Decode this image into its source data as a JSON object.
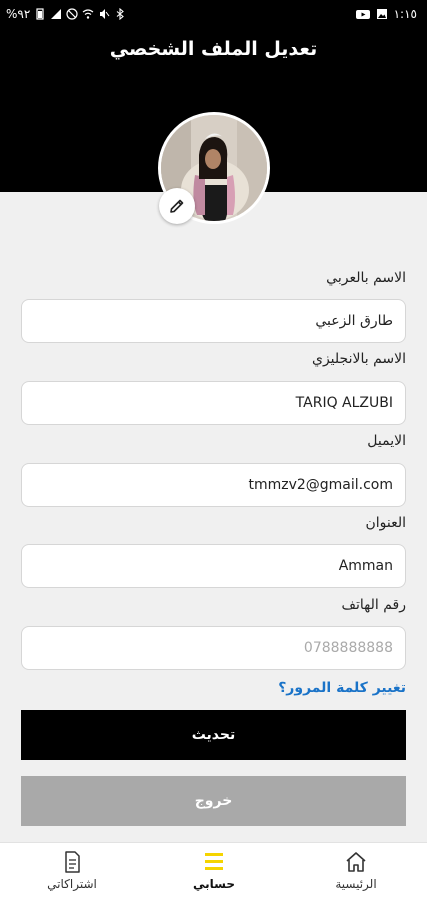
{
  "status_bar": {
    "time": "١:١٥",
    "battery": "%٩٢"
  },
  "header": {
    "title": "تعديل الملف الشخصي"
  },
  "form": {
    "arabic_name": {
      "label": "الاسم بالعربي",
      "value": "طارق الزعبي"
    },
    "english_name": {
      "label": "الاسم بالانجليزي",
      "value": "TARIQ ALZUBI"
    },
    "email": {
      "label": "الايميل",
      "value": "tmmzv2@gmail.com"
    },
    "address": {
      "label": "العنوان",
      "value": "Amman"
    },
    "phone": {
      "label": "رقم الهاتف",
      "placeholder": "0788888888"
    }
  },
  "forgot_password": "تغيير كلمة المرور؟",
  "buttons": {
    "update": "تحديث",
    "logout": "خروج"
  },
  "bottom_nav": {
    "home": "الرئيسية",
    "account": "حسابي",
    "subscriptions": "اشتراكاتي"
  },
  "colors": {
    "header_bg": "#000000",
    "accent": "#f5d400",
    "link": "#1a73c8",
    "logout_bg": "#a9a9a9"
  }
}
